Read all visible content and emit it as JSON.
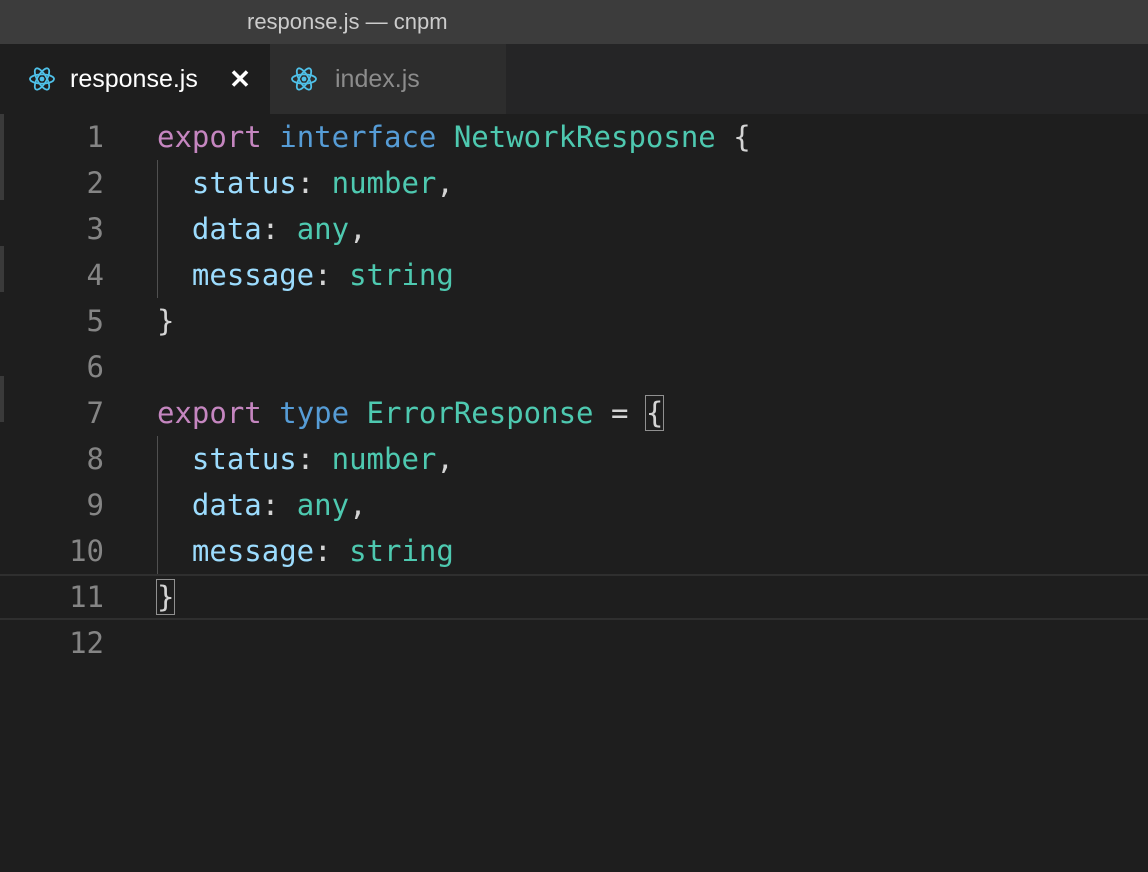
{
  "window": {
    "title": "response.js — cnpm"
  },
  "tabs": [
    {
      "label": "response.js",
      "icon": "react-icon",
      "active": true,
      "close": "✕"
    },
    {
      "label": "index.js",
      "icon": "react-icon",
      "active": false
    }
  ],
  "colors": {
    "keyword_purple": "#c586c0",
    "keyword_blue": "#569cd6",
    "type": "#4ec9b0",
    "property": "#9cdcfe",
    "react_icon": "#4fc1e9"
  },
  "editor": {
    "lines": [
      {
        "n": "1",
        "tokens": [
          [
            "kw-purple",
            "export"
          ],
          [
            "punc",
            " "
          ],
          [
            "kw-blue",
            "interface"
          ],
          [
            "punc",
            " "
          ],
          [
            "type",
            "NetworkResposne"
          ],
          [
            "punc",
            " {"
          ]
        ]
      },
      {
        "n": "2",
        "tokens": [
          [
            "punc",
            "  "
          ],
          [
            "prop",
            "status"
          ],
          [
            "punc",
            ": "
          ],
          [
            "type",
            "number"
          ],
          [
            "punc",
            ","
          ]
        ]
      },
      {
        "n": "3",
        "tokens": [
          [
            "punc",
            "  "
          ],
          [
            "prop",
            "data"
          ],
          [
            "punc",
            ": "
          ],
          [
            "type",
            "any"
          ],
          [
            "punc",
            ","
          ]
        ]
      },
      {
        "n": "4",
        "tokens": [
          [
            "punc",
            "  "
          ],
          [
            "prop",
            "message"
          ],
          [
            "punc",
            ": "
          ],
          [
            "type",
            "string"
          ]
        ]
      },
      {
        "n": "5",
        "tokens": [
          [
            "punc",
            "}"
          ]
        ]
      },
      {
        "n": "6",
        "tokens": []
      },
      {
        "n": "7",
        "tokens": [
          [
            "kw-purple",
            "export"
          ],
          [
            "punc",
            " "
          ],
          [
            "kw-blue",
            "type"
          ],
          [
            "punc",
            " "
          ],
          [
            "type",
            "ErrorResponse"
          ],
          [
            "punc",
            " = "
          ],
          [
            "punc bracket-match",
            "{"
          ]
        ]
      },
      {
        "n": "8",
        "tokens": [
          [
            "punc",
            "  "
          ],
          [
            "prop",
            "status"
          ],
          [
            "punc",
            ": "
          ],
          [
            "type",
            "number"
          ],
          [
            "punc",
            ","
          ]
        ]
      },
      {
        "n": "9",
        "tokens": [
          [
            "punc",
            "  "
          ],
          [
            "prop",
            "data"
          ],
          [
            "punc",
            ": "
          ],
          [
            "type",
            "any"
          ],
          [
            "punc",
            ","
          ]
        ]
      },
      {
        "n": "10",
        "tokens": [
          [
            "punc",
            "  "
          ],
          [
            "prop",
            "message"
          ],
          [
            "punc",
            ": "
          ],
          [
            "type",
            "string"
          ]
        ]
      },
      {
        "n": "11",
        "tokens": [
          [
            "punc bracket-match",
            "}"
          ]
        ],
        "current": true
      },
      {
        "n": "12",
        "tokens": []
      }
    ]
  }
}
